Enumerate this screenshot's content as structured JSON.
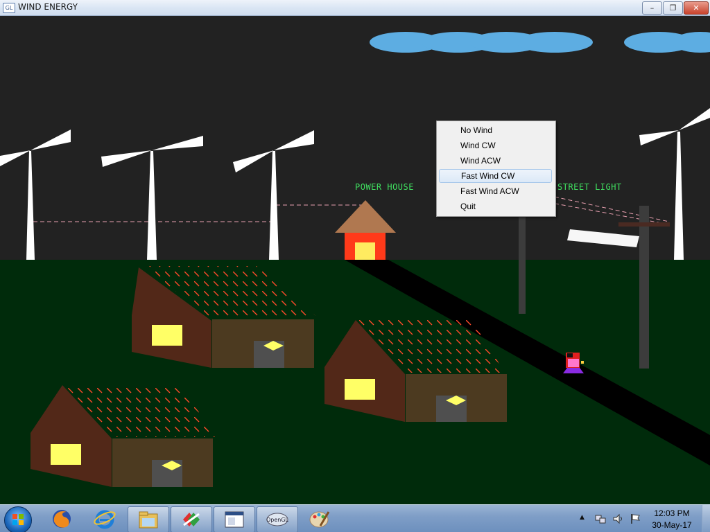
{
  "window": {
    "title": "WIND ENERGY",
    "app_icon_text": "GL",
    "controls": {
      "minimize_icon": "minimize-icon",
      "maximize_icon": "restore-icon",
      "close_icon": "close-icon"
    }
  },
  "scene": {
    "sky_color": "#222222",
    "ground_color": "#002b0b",
    "labels": {
      "power_house": "POWER HOUSE",
      "street_light": "STREET LIGHT"
    }
  },
  "context_menu": {
    "items": [
      {
        "label": "No Wind"
      },
      {
        "label": "Wind CW"
      },
      {
        "label": "Wind ACW"
      },
      {
        "label": "Fast Wind CW",
        "selected": true
      },
      {
        "label": "Fast Wind ACW"
      },
      {
        "label": "Quit"
      }
    ]
  },
  "taskbar": {
    "start_icon": "windows-start-icon",
    "pinned": [
      "firefox-icon",
      "internet-explorer-icon",
      "file-explorer-icon",
      "app-icon",
      "window-app-icon",
      "opengl-icon",
      "paint-icon"
    ],
    "opengl_label": "OpenGL",
    "tray_icons": [
      "show-hidden-icons-icon",
      "network-icon",
      "volume-icon",
      "action-center-flag-icon"
    ],
    "clock": {
      "time": "12:03 PM",
      "date": "30-May-17"
    }
  }
}
